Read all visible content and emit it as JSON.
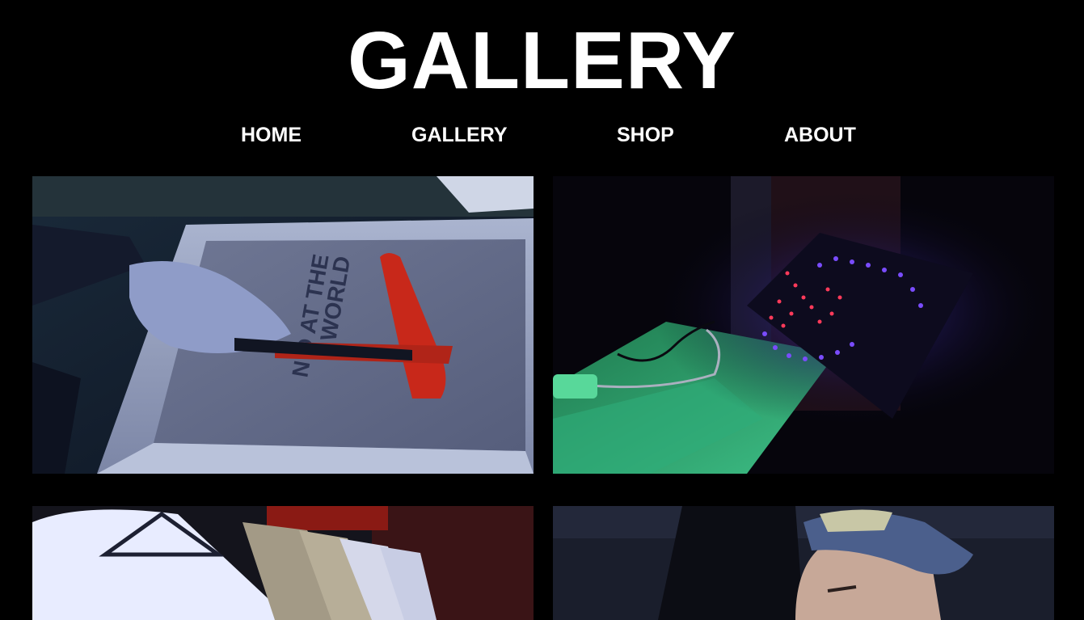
{
  "site": {
    "title": "GALLERY"
  },
  "nav": {
    "items": [
      {
        "label": "HOME"
      },
      {
        "label": "GALLERY"
      },
      {
        "label": "SHOP"
      },
      {
        "label": "ABOUT"
      }
    ]
  },
  "gallery": {
    "photos": [
      {
        "subject": "screen-printing-photo",
        "print_text_line1": "N  D AT THE",
        "print_text_line2": "WORLD"
      },
      {
        "subject": "led-sign-photo"
      },
      {
        "subject": "clothing-rack-photo"
      },
      {
        "subject": "portrait-cap-photo"
      }
    ]
  },
  "colors": {
    "background": "#000000",
    "text": "#ffffff",
    "paint_red": "#c8281a",
    "led_purple": "#7a4cff",
    "led_red": "#ff3a5a",
    "tile_green": "#2fae7a"
  }
}
